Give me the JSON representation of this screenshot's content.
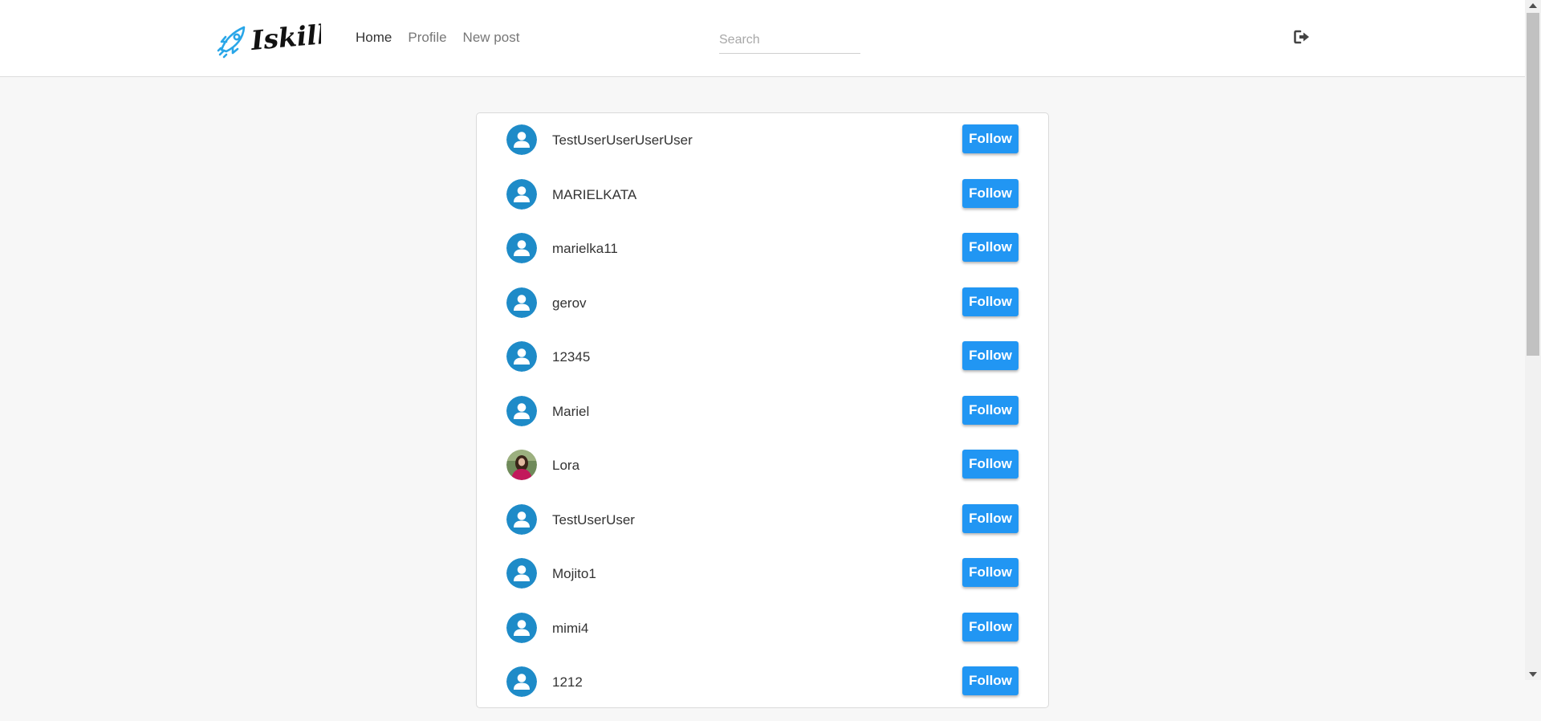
{
  "brand": {
    "name": "Iskillo",
    "accent_color": "#2196f3",
    "icon": "rocket-icon"
  },
  "nav": {
    "links": [
      {
        "label": "Home",
        "active": true
      },
      {
        "label": "Profile",
        "active": false
      },
      {
        "label": "New post",
        "active": false
      }
    ]
  },
  "search": {
    "placeholder": "Search",
    "value": ""
  },
  "header": {
    "logout_icon": "sign-out-icon"
  },
  "users": {
    "follow_label": "Follow",
    "items": [
      {
        "name": "TestUserUserUserUser",
        "avatar": "default-user-icon"
      },
      {
        "name": "MARIELKATA",
        "avatar": "default-user-icon"
      },
      {
        "name": "marielka11",
        "avatar": "default-user-icon"
      },
      {
        "name": "gerov",
        "avatar": "default-user-icon"
      },
      {
        "name": "12345",
        "avatar": "default-user-icon"
      },
      {
        "name": "Mariel",
        "avatar": "default-user-icon"
      },
      {
        "name": "Lora",
        "avatar": "profile-photo"
      },
      {
        "name": "TestUserUser",
        "avatar": "default-user-icon"
      },
      {
        "name": "Mojito1",
        "avatar": "default-user-icon"
      },
      {
        "name": "mimi4",
        "avatar": "default-user-icon"
      },
      {
        "name": "1212",
        "avatar": "default-user-icon"
      }
    ]
  }
}
